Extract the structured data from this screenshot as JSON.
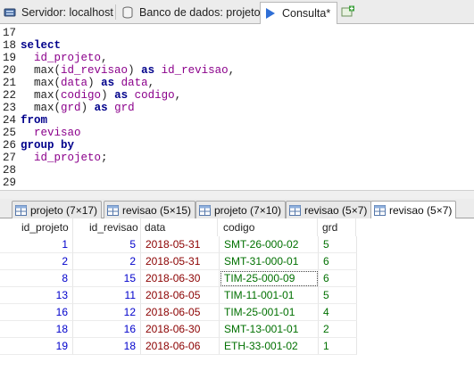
{
  "tabs": [
    {
      "label": "Servidor: localhost",
      "icon": "server-icon"
    },
    {
      "label": "Banco de dados: projeto",
      "icon": "database-icon"
    },
    {
      "label": "Consulta*",
      "icon": "play-icon",
      "active": true
    }
  ],
  "editor": {
    "lines": [
      {
        "n": "17",
        "t": ""
      },
      {
        "n": "18",
        "t": "select"
      },
      {
        "n": "19",
        "t": "  id_projeto,"
      },
      {
        "n": "20",
        "t": "  max(id_revisao) as id_revisao,"
      },
      {
        "n": "21",
        "t": "  max(data) as data,"
      },
      {
        "n": "22",
        "t": "  max(codigo) as codigo,"
      },
      {
        "n": "23",
        "t": "  max(grd) as grd"
      },
      {
        "n": "24",
        "t": "from"
      },
      {
        "n": "25",
        "t": "  revisao"
      },
      {
        "n": "26",
        "t": "group by"
      },
      {
        "n": "27",
        "t": "  id_projeto;"
      },
      {
        "n": "28",
        "t": ""
      },
      {
        "n": "29",
        "t": ""
      }
    ]
  },
  "result_tabs": [
    {
      "label": "projeto (7×17)"
    },
    {
      "label": "revisao (5×15)"
    },
    {
      "label": "projeto (7×10)"
    },
    {
      "label": "revisao (5×7)"
    },
    {
      "label": "revisao (5×7)",
      "active": true
    }
  ],
  "grid": {
    "columns": [
      "id_projeto",
      "id_revisao",
      "data",
      "codigo",
      "grd"
    ],
    "rows": [
      [
        "1",
        "5",
        "2018-05-31",
        "SMT-26-000-02",
        "5"
      ],
      [
        "2",
        "2",
        "2018-05-31",
        "SMT-31-000-01",
        "6"
      ],
      [
        "8",
        "15",
        "2018-06-30",
        "TIM-25-000-09",
        "6"
      ],
      [
        "13",
        "11",
        "2018-06-05",
        "TIM-11-001-01",
        "5"
      ],
      [
        "16",
        "12",
        "2018-06-05",
        "TIM-25-001-01",
        "4"
      ],
      [
        "18",
        "16",
        "2018-06-30",
        "SMT-13-001-01",
        "2"
      ],
      [
        "19",
        "18",
        "2018-06-06",
        "ETH-33-001-02",
        "1"
      ]
    ]
  },
  "colors": {
    "keyword": "#00008b",
    "identifier": "#8b008b",
    "number": "#0000cc",
    "date": "#8b0000",
    "string": "#007000"
  }
}
